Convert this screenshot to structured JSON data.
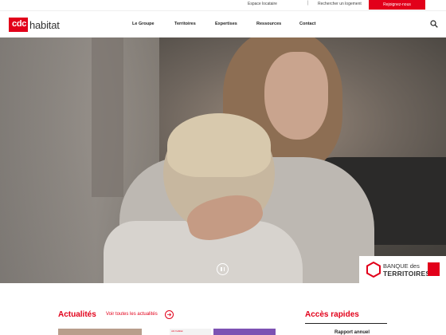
{
  "topbar": {
    "espace_locataire": "Espace locataire",
    "separator": "|",
    "rechercher_logement": "Rechercher un logement",
    "rejoignez": "Rejoignez-nous"
  },
  "header": {
    "logo_cdc": "cdc",
    "logo_habitat": "habitat",
    "nav": [
      "Le Groupe",
      "Territoires",
      "Expertises",
      "Ressources",
      "Contact"
    ]
  },
  "badge": {
    "line1": "BANQUE des",
    "line2": "TERRITOIRES"
  },
  "sections": {
    "actualites_title": "Actualités",
    "voir_toutes": "Voir toutes les actualités",
    "acces_title": "Accès rapides",
    "thumb_label": "cdc habitat",
    "quick_item": "Rapport annuel"
  },
  "colors": {
    "brand_red": "#e2001a"
  }
}
